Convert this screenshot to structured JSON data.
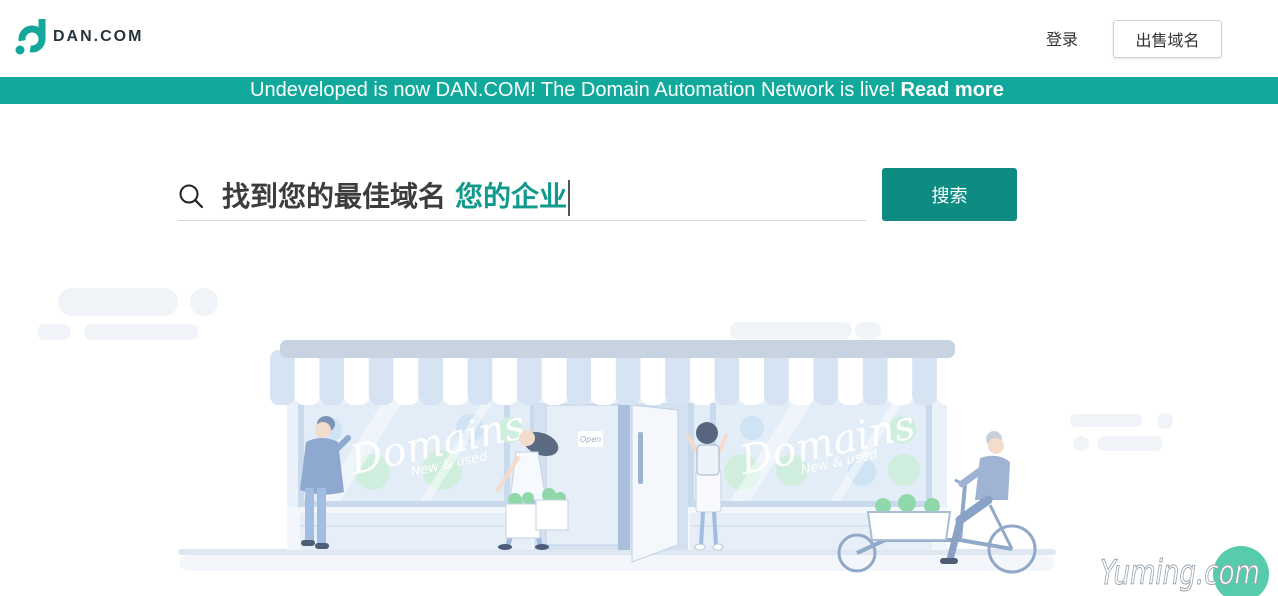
{
  "header": {
    "logo_text": "DAN.COM",
    "login_label": "登录",
    "sell_button_label": "出售域名"
  },
  "banner": {
    "message": "Undeveloped is now DAN.COM! The Domain Automation Network is live!",
    "link_label": "Read more"
  },
  "search": {
    "headline": "找到您的最佳域名",
    "highlight": "您的企业",
    "button_label": "搜索"
  },
  "illustration": {
    "window_sign_left": "Domains",
    "window_sub_left": "New & used",
    "window_sign_right": "Domains",
    "window_sub_right": "New & used",
    "door_sign": "Open"
  },
  "watermark": {
    "text": "Yuming.com"
  },
  "colors": {
    "brand_teal": "#10a99b",
    "button_teal": "#0e8c82",
    "highlight_teal": "#11998d",
    "text_dark": "#3c3c3c"
  },
  "icons": {
    "logo": "dan-logo-icon",
    "search": "search-icon"
  }
}
